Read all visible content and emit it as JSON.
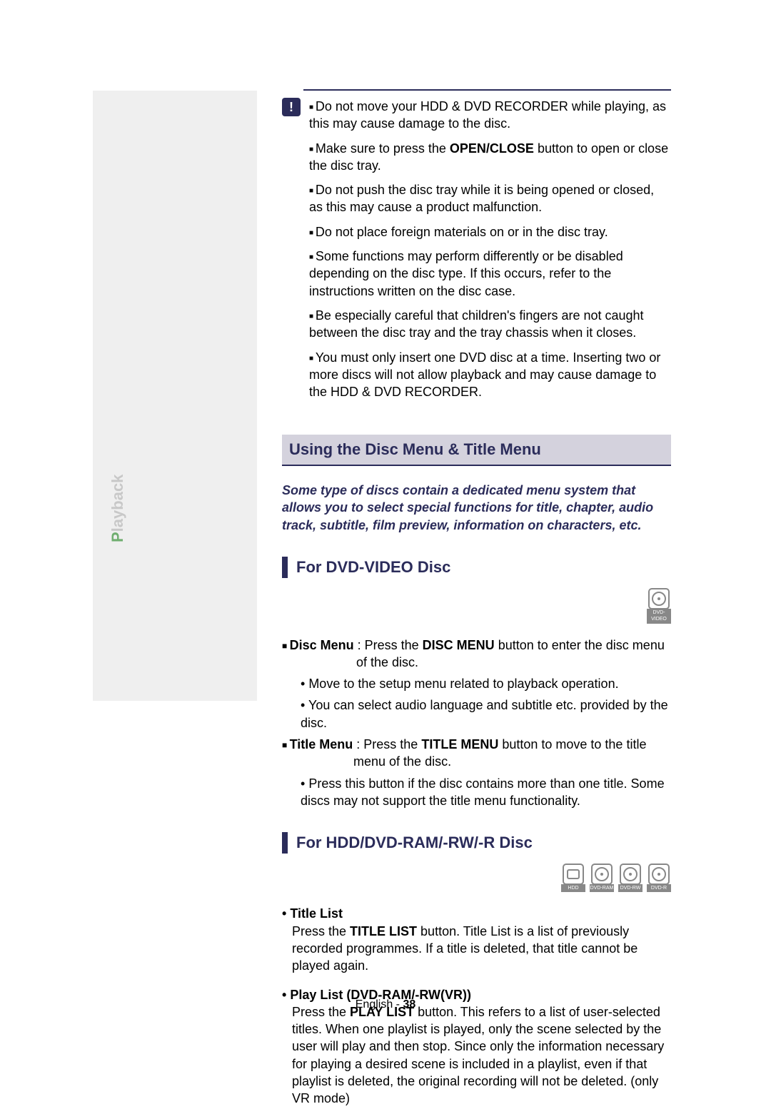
{
  "sidebar": {
    "label": "Playback"
  },
  "cautions": [
    "Do not move your HDD & DVD RECORDER while playing, as this may cause damage to the disc.",
    "Make sure to press the OPEN/CLOSE button to open or close the disc tray.",
    "Do not push the disc tray while it is being opened or closed, as this may cause a product malfunction.",
    "Do not place foreign materials on or in the disc tray.",
    "Some functions may perform differently or be disabled depending on the disc type. If this occurs, refer to the instructions written on the disc case.",
    "Be especially careful that children's fingers are not caught between the disc tray and the tray chassis when it closes.",
    "You must only insert one DVD disc at a time. Inserting two or more discs will not allow playback and may cause damage to the HDD & DVD RECORDER."
  ],
  "sections": {
    "main_header": "Using the Disc Menu & Title Menu",
    "intro": "Some type of discs contain a dedicated menu system that allows you to select special functions for title, chapter, audio track, subtitle, film preview, information on characters, etc.",
    "dvd_video": {
      "title": "For DVD-VIDEO Disc",
      "icon_labels": [
        "DVD-VIDEO"
      ],
      "items": [
        {
          "lead_bold": "Disc Menu",
          "lead_rest": " : Press the ",
          "lead_bold2": "DISC MENU",
          "lead_rest2": " button to enter the disc menu of the disc.",
          "subs": [
            "Move to the setup menu related to playback operation.",
            "You can select audio language and subtitle etc. provided by the disc."
          ]
        },
        {
          "lead_bold": "Title Menu",
          "lead_rest": " : Press the ",
          "lead_bold2": "TITLE MENU",
          "lead_rest2": " button to move to the title menu of the disc.",
          "subs": [
            "Press this button if the disc contains more than one title. Some discs may not support the title menu functionality."
          ]
        }
      ]
    },
    "hdd": {
      "title": "For HDD/DVD-RAM/-RW/-R Disc",
      "icon_labels": [
        "HDD",
        "DVD-RAM",
        "DVD-RW",
        "DVD-R"
      ],
      "bullets": [
        {
          "heading": "Title List",
          "body_pre": "Press the ",
          "body_bold": "TITLE LIST",
          "body_post": " button. Title List is a list of previously recorded programmes. If a title is deleted, that title cannot be played again."
        },
        {
          "heading": "Play List (DVD-RAM/-RW(VR))",
          "body_pre": "Press the ",
          "body_bold": "PLAY LIST",
          "body_post": " button. This refers to a list of user-selected titles. When one playlist is played, only the scene selected by the user will play and then stop. Since only the information necessary for playing a desired scene is included in a playlist, even if that playlist is deleted, the original recording will not be deleted. (only VR mode)"
        }
      ]
    }
  },
  "footer": {
    "lang": "English",
    "sep": " - ",
    "page": "38"
  }
}
